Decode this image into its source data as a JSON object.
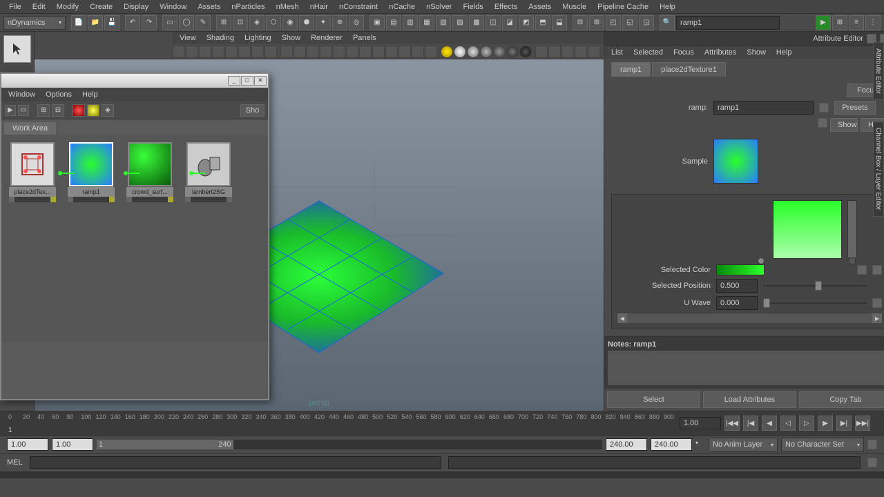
{
  "menubar": [
    "File",
    "Edit",
    "Modify",
    "Create",
    "Display",
    "Window",
    "Assets",
    "nParticles",
    "nMesh",
    "nHair",
    "nConstraint",
    "nCache",
    "nSolver",
    "Fields",
    "Effects",
    "Assets",
    "Muscle",
    "Pipeline Cache",
    "Help"
  ],
  "module_dropdown": "nDynamics",
  "panel_menu_left": [
    "Display",
    "Show",
    "Panels"
  ],
  "viewport_menu": [
    "View",
    "Shading",
    "Lighting",
    "Show",
    "Renderer",
    "Panels"
  ],
  "side_tabs": [
    "Attribute Editor",
    "Channel Box / Layer Editor"
  ],
  "attr_editor": {
    "title": "Attribute Editor",
    "menus": [
      "List",
      "Selected",
      "Focus",
      "Attributes",
      "Show",
      "Help"
    ],
    "tabs": [
      "ramp1",
      "place2dTexture1"
    ],
    "focus_btn": "Focus",
    "presets_btn": "Presets",
    "show_btn": "Show",
    "hide_btn": "Hide",
    "node_type_label": "ramp:",
    "node_name": "ramp1",
    "sample_label": "Sample",
    "selected_color_label": "Selected Color",
    "selected_position_label": "Selected Position",
    "selected_position_value": "0.500",
    "u_wave_label": "U Wave",
    "u_wave_value": "0.000",
    "notes_label": "Notes: ramp1",
    "bottom_buttons": [
      "Select",
      "Load Attributes",
      "Copy Tab"
    ]
  },
  "hypershade": {
    "menus": [
      "Window",
      "Options",
      "Help"
    ],
    "tab": "Work Area",
    "show_btn": "Sho",
    "nodes": [
      {
        "name": "place2dTex...",
        "type": "place2d"
      },
      {
        "name": "ramp1",
        "type": "ramp",
        "selected": true
      },
      {
        "name": "crowd_surf...",
        "type": "surface"
      },
      {
        "name": "lambert2SG",
        "type": "sg"
      }
    ]
  },
  "viewport": {
    "persp_label": "persp"
  },
  "timeline": {
    "ticks": [
      "0",
      "20",
      "40",
      "60",
      "80",
      "100",
      "120",
      "140",
      "160",
      "180",
      "200",
      "220",
      "240",
      "260",
      "280",
      "300",
      "320",
      "340",
      "360",
      "380",
      "400",
      "420",
      "440",
      "460",
      "480",
      "500",
      "520",
      "540",
      "560",
      "580",
      "600",
      "620",
      "640",
      "660",
      "680",
      "700",
      "720",
      "740",
      "760",
      "780",
      "800",
      "820",
      "840",
      "860",
      "880",
      "900"
    ],
    "current_frame": "1",
    "start_time": "1.00",
    "start_range": "1.00",
    "range_slider_start": "1",
    "range_slider_end": "240",
    "end_range": "240.00",
    "end_time": "240.00",
    "frame_input": "1.00",
    "anim_layer": "No Anim Layer",
    "char_set": "No Character Set"
  },
  "mel": {
    "label": "MEL"
  },
  "search_field": "ramp1"
}
